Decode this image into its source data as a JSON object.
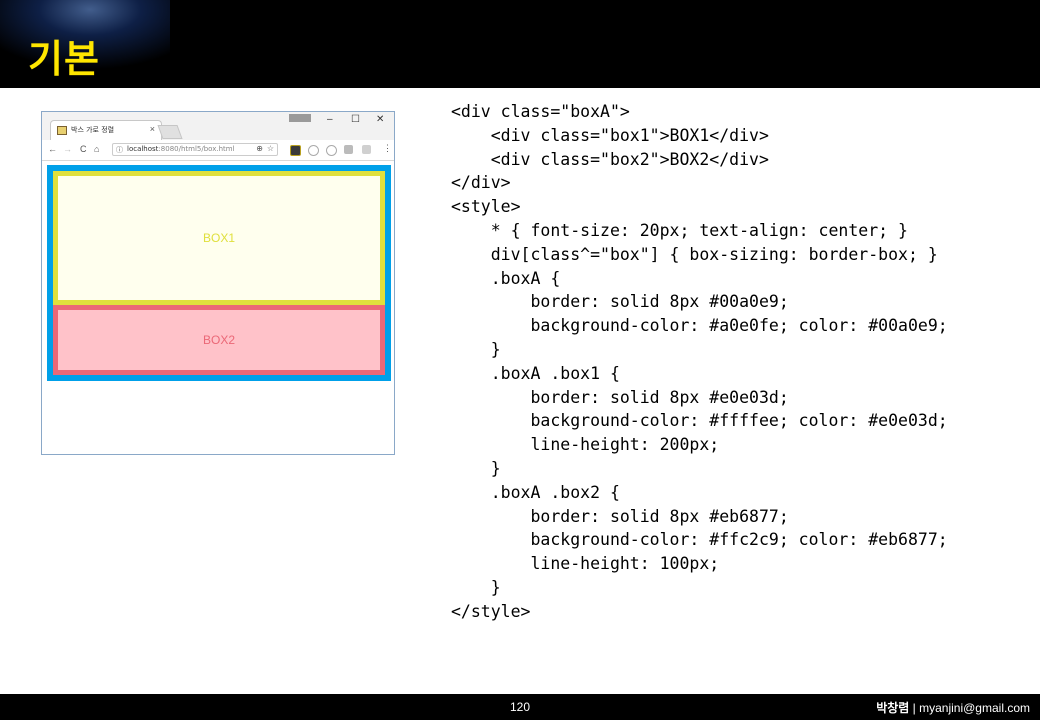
{
  "slide": {
    "title": "기본",
    "page_number": "120",
    "author_name": "박창렴",
    "author_separator": " | ",
    "author_email": "myanjini@gmail.com"
  },
  "browser": {
    "tab_title": "박스 가로 정렬",
    "tab_close": "×",
    "window_controls": {
      "minimize": "–",
      "maximize": "☐",
      "close": "✕"
    },
    "nav": {
      "back": "←",
      "forward": "→",
      "reload": "C",
      "home": "⌂"
    },
    "url_host": "localhost",
    "url_rest": ":8080/html5/box.html",
    "icons": [
      "back-arrow-icon",
      "forward-arrow-icon",
      "reload-icon",
      "home-icon",
      "info-icon",
      "zoom-icon",
      "star-icon",
      "menu-icon"
    ],
    "page": {
      "box1_label": "BOX1",
      "box2_label": "BOX2"
    },
    "colors": {
      "boxA_border": "#00a0e9",
      "boxA_bg": "#a0e0fe",
      "box1_border": "#e0e03d",
      "box1_bg": "#ffffee",
      "box2_border": "#eb6877",
      "box2_bg": "#ffc2c9"
    }
  },
  "code": {
    "lines": [
      "<div class=\"boxA\">",
      "    <div class=\"box1\">BOX1</div>",
      "    <div class=\"box2\">BOX2</div>",
      "</div>",
      "<style>",
      "    * { font-size: 20px; text-align: center; }",
      "    div[class^=\"box\"] { box-sizing: border-box; }",
      "    .boxA {",
      "        border: solid 8px #00a0e9;",
      "        background-color: #a0e0fe; color: #00a0e9;",
      "    }",
      "    .boxA .box1 {",
      "        border: solid 8px #e0e03d;",
      "        background-color: #ffffee; color: #e0e03d;",
      "        line-height: 200px;",
      "    }",
      "    .boxA .box2 {",
      "        border: solid 8px #eb6877;",
      "        background-color: #ffc2c9; color: #eb6877;",
      "        line-height: 100px;",
      "    }",
      "</style>"
    ]
  }
}
